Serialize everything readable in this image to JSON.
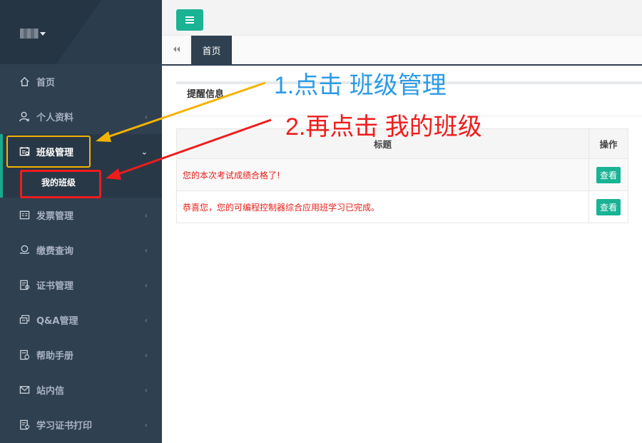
{
  "sidebar": {
    "items": [
      {
        "label": "首页",
        "icon": "home-icon",
        "has_arrow": false
      },
      {
        "label": "个人资料",
        "icon": "user-icon",
        "has_arrow": true
      },
      {
        "label": "班级管理",
        "icon": "class-icon",
        "has_arrow": true,
        "expanded": true
      },
      {
        "label": "发票管理",
        "icon": "invoice-icon",
        "has_arrow": true
      },
      {
        "label": "缴费查询",
        "icon": "payment-icon",
        "has_arrow": true
      },
      {
        "label": "证书管理",
        "icon": "certificate-icon",
        "has_arrow": true
      },
      {
        "label": "Q&A管理",
        "icon": "chat-icon",
        "has_arrow": true
      },
      {
        "label": "帮助手册",
        "icon": "help-icon",
        "has_arrow": true
      },
      {
        "label": "站内信",
        "icon": "mail-icon",
        "has_arrow": true
      },
      {
        "label": "学习证书打印",
        "icon": "print-certificate-icon",
        "has_arrow": true
      }
    ],
    "submenu": {
      "label": "我的班级"
    }
  },
  "header": {
    "menu_icon": "hamburger-icon"
  },
  "tabs": [
    {
      "label": "首页"
    }
  ],
  "panel": {
    "title": "提醒信息"
  },
  "table": {
    "columns": [
      "标题",
      "操作"
    ],
    "rows": [
      {
        "title": "您的本次考试成绩合格了!",
        "action": "查看"
      },
      {
        "title": "恭喜您，您的可编程控制器综合应用班学习已完成。",
        "action": "查看"
      }
    ]
  },
  "annotations": {
    "step1": "1.点击 班级管理",
    "step2": "2.再点击 我的班级",
    "colors": {
      "step1": "#2b9be6",
      "step2": "#ef1c1c",
      "highlight_box": "#f5b301"
    }
  },
  "colors": {
    "sidebar_bg": "#2f4050",
    "accent": "#1ab394",
    "message_text": "#e4201a"
  }
}
